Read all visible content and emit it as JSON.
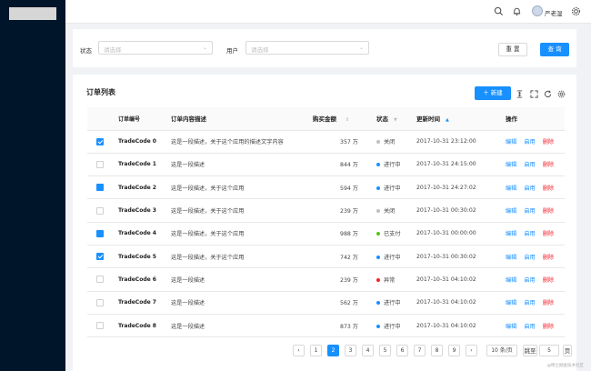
{
  "topbar": {
    "user_name": "严老湿",
    "icons": [
      "search-icon",
      "bell-icon",
      "user-avatar",
      "settings-icon"
    ]
  },
  "filter": {
    "status_label": "状态",
    "status_placeholder": "请选择",
    "user_label": "用户",
    "user_placeholder": "请选择",
    "reset_label": "重 置",
    "query_label": "查 询"
  },
  "card": {
    "title": "订单列表",
    "new_label": "新建"
  },
  "table": {
    "columns": {
      "code": "订单编号",
      "desc": "订单内容描述",
      "amount": "购买金额",
      "status": "状态",
      "time": "更新时间",
      "ops": "操作"
    },
    "ops": {
      "edit": "编辑",
      "enable": "启用",
      "delete": "删除"
    },
    "rows": [
      {
        "code": "TradeCode 0",
        "desc": "这是一段描述，关于这个应用的描述文字内容",
        "amount": "357 万",
        "status": "关闭",
        "status_color": "#bfbfbf",
        "time": "2017-10-31  23:12:00",
        "checked": true,
        "tick": true
      },
      {
        "code": "TradeCode 1",
        "desc": "这是一段描述",
        "amount": "844 万",
        "status": "进行中",
        "status_color": "#1890ff",
        "time": "2017-10-31  24:15:00",
        "checked": false,
        "tick": false
      },
      {
        "code": "TradeCode 2",
        "desc": "这是一段描述，关于这个应用",
        "amount": "594 万",
        "status": "进行中",
        "status_color": "#1890ff",
        "time": "2017-10-31  24:27:02",
        "checked": true,
        "tick": false
      },
      {
        "code": "TradeCode 3",
        "desc": "这是一段描述，关于这个应用",
        "amount": "239 万",
        "status": "关闭",
        "status_color": "#bfbfbf",
        "time": "2017-10-31  00:30:02",
        "checked": false,
        "tick": false
      },
      {
        "code": "TradeCode 4",
        "desc": "这是一段描述，关于这个应用",
        "amount": "988 万",
        "status": "已支付",
        "status_color": "#52c41a",
        "time": "2017-10-31  00:00:00",
        "checked": true,
        "tick": false
      },
      {
        "code": "TradeCode 5",
        "desc": "这是一段描述，关于这个应用",
        "amount": "742 万",
        "status": "进行中",
        "status_color": "#1890ff",
        "time": "2017-10-31  00:30:02",
        "checked": true,
        "tick": true
      },
      {
        "code": "TradeCode 6",
        "desc": "这是一段描述",
        "amount": "239 万",
        "status": "异常",
        "status_color": "#f5222d",
        "time": "2017-10-31  04:10:02",
        "checked": false,
        "tick": false
      },
      {
        "code": "TradeCode 7",
        "desc": "这是一段描述",
        "amount": "562 万",
        "status": "进行中",
        "status_color": "#1890ff",
        "time": "2017-10-31  04:10:02",
        "checked": false,
        "tick": false
      },
      {
        "code": "TradeCode 8",
        "desc": "这是一段描述",
        "amount": "873 万",
        "status": "进行中",
        "status_color": "#1890ff",
        "time": "2017-10-31  04:10:02",
        "checked": false,
        "tick": false
      }
    ]
  },
  "pagination": {
    "prev": "‹",
    "next": "›",
    "pages": [
      "1",
      "2",
      "3",
      "4",
      "5",
      "6",
      "7",
      "8",
      "9"
    ],
    "current": "2",
    "page_size": "10 条/页",
    "jump_label": "跳至",
    "jump_value": "5",
    "page_unit": "页"
  },
  "watermark": "@稀土掘金技术社区",
  "colors": {
    "primary": "#1890ff",
    "sidebar": "#001529",
    "danger": "#f5222d"
  }
}
